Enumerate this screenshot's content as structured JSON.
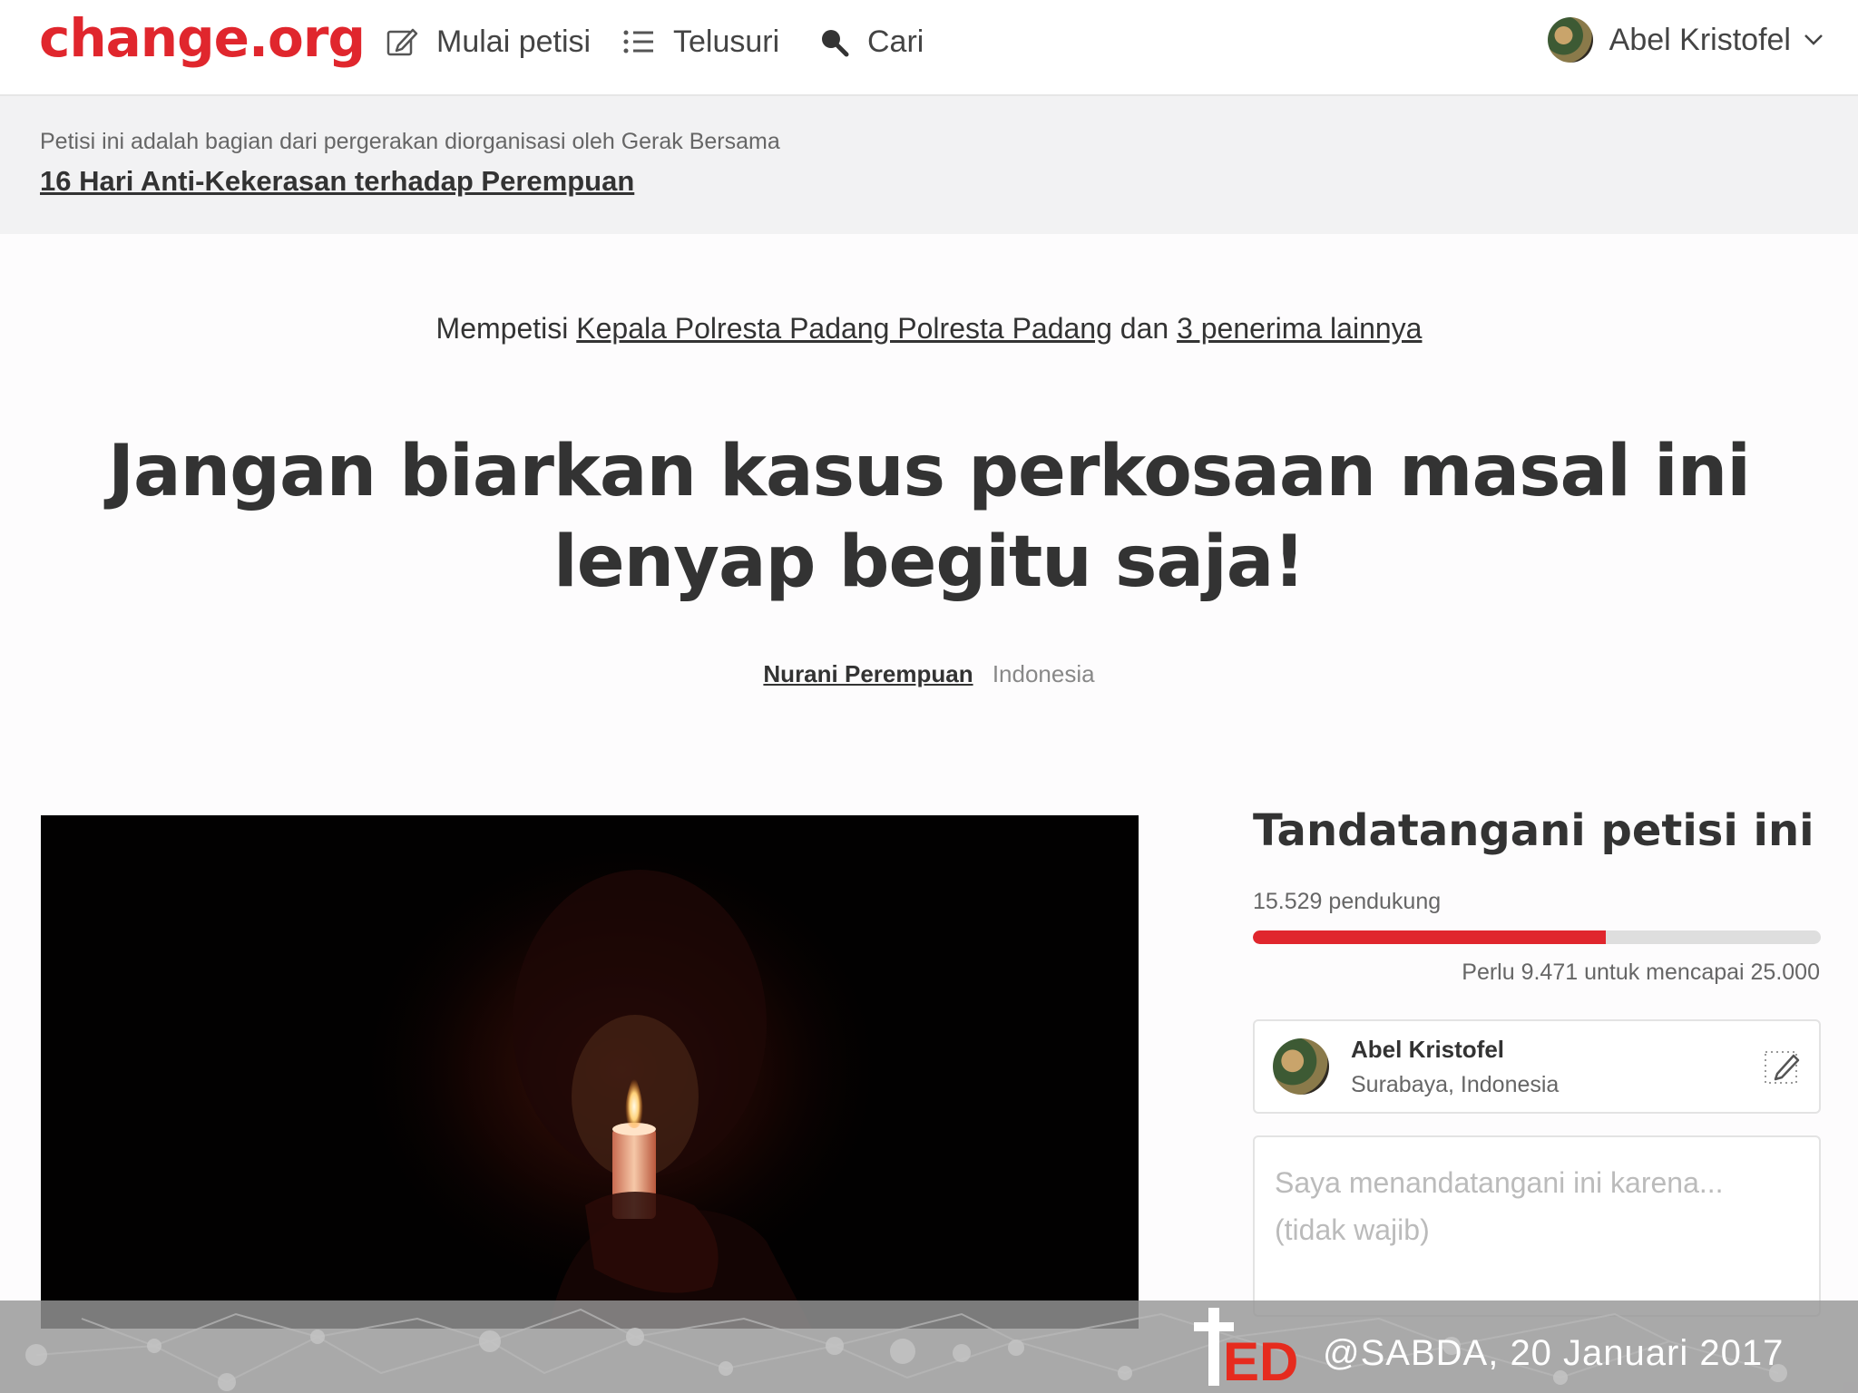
{
  "nav": {
    "logo": "change.org",
    "start_label": "Mulai petisi",
    "browse_label": "Telusuri",
    "search_label": "Cari",
    "user_name": "Abel Kristofel"
  },
  "movement": {
    "note": "Petisi ini adalah bagian dari pergerakan diorganisasi oleh Gerak Bersama",
    "title": "16 Hari Anti-Kekerasan terhadap Perempuan"
  },
  "petition": {
    "target_prefix": "Mempetisi",
    "target_name": "Kepala Polresta Padang Polresta Padang",
    "target_joiner": "dan",
    "target_others": "3 penerima lainnya",
    "title": "Jangan biarkan kasus perkosaan masal ini lenyap begitu saja!",
    "author": "Nurani Perempuan",
    "author_location": "Indonesia"
  },
  "sign": {
    "title": "Tandatangani petisi ini",
    "supporters": "15.529 pendukung",
    "progress_fraction": 0.621,
    "goal_note": "Perlu 9.471 untuk mencapai 25.000",
    "signer_name": "Abel Kristofel",
    "signer_location": "Surabaya, Indonesia",
    "reason_placeholder": "Saya menandatangani ini karena... (tidak wajib)"
  },
  "watermark": {
    "text": "@SABDA, 20 Januari 2017"
  },
  "colors": {
    "brand": "#e0262d",
    "text": "#333333",
    "muted": "#666666"
  },
  "icons": [
    "edit-icon",
    "list-icon",
    "search-icon",
    "chevron-down-icon",
    "cross-icon"
  ]
}
